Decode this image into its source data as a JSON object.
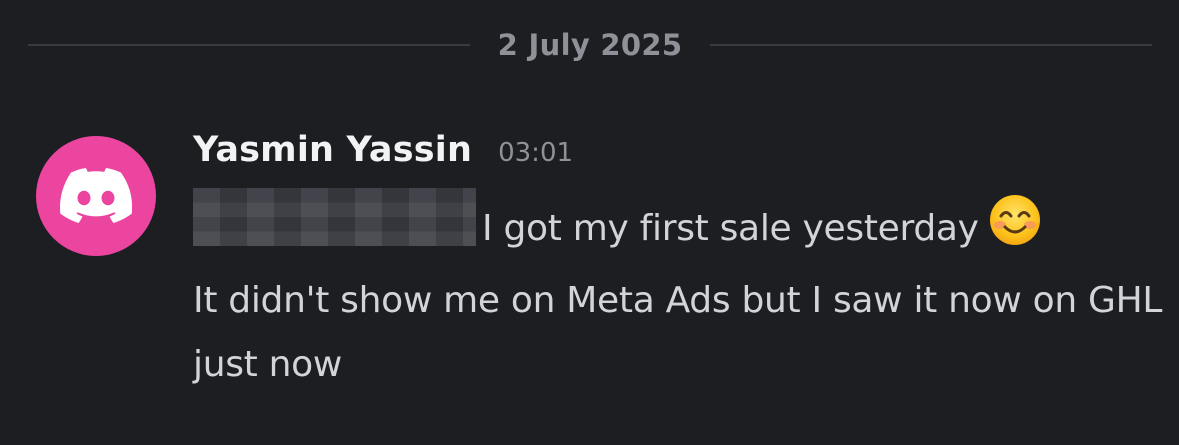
{
  "date_divider": {
    "label": "2 July 2025"
  },
  "message": {
    "author": "Yasmin Yassin",
    "timestamp": "03:01",
    "avatar_icon": "discord-logo-icon",
    "avatar_color": "#eb459f",
    "line1_text": "I got my first sale yesterday",
    "line1_emoji": "smiling-face-emoji",
    "line2_text": "It didn't show me on Meta Ads but I saw it now on GHL just now"
  }
}
